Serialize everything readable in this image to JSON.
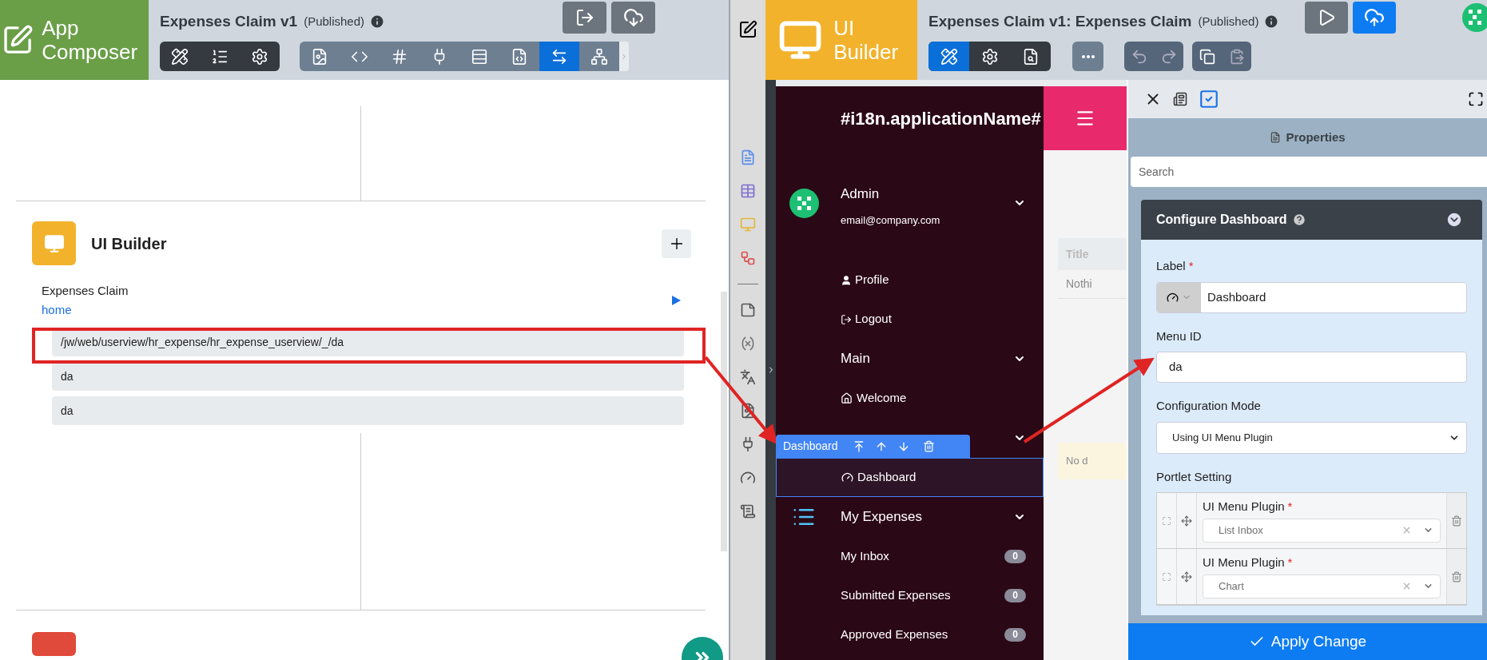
{
  "app_composer": {
    "brand": "App Composer",
    "title": "Expenses Claim v1",
    "status": "(Published)",
    "toolbar_left": [
      {
        "selected": false
      },
      {
        "selected": false
      },
      {
        "selected": false
      }
    ],
    "toolbar_right": [
      {
        "selected": false
      },
      {
        "selected": false
      },
      {
        "selected": false
      },
      {
        "selected": false
      },
      {
        "selected": false
      },
      {
        "selected": false
      },
      {
        "selected": true
      },
      {
        "selected": false
      }
    ],
    "section": {
      "title": "UI Builder",
      "item": {
        "name": "Expenses Claim",
        "link": "home"
      },
      "rows": [
        {
          "text": "/jw/web/userview/hr_expense/hr_expense_userview/_/da"
        },
        {
          "text": "da"
        },
        {
          "text": "da"
        }
      ]
    }
  },
  "ui_builder": {
    "brand": "UI Builder",
    "title": "Expenses Claim v1: Expenses Claim",
    "status": "(Published)",
    "toolbar": [
      {
        "selected": true
      },
      {
        "selected": false
      },
      {
        "selected": false
      }
    ]
  },
  "userview": {
    "app_name": "#i18n.applicationName#",
    "user": {
      "name": "Admin",
      "email": "email@company.com",
      "expanded": true,
      "links": [
        {
          "label": "Profile"
        },
        {
          "label": "Logout"
        }
      ]
    },
    "categories": [
      {
        "label": "Main",
        "expanded": true,
        "items": [
          {
            "label": "Welcome",
            "selected": false
          }
        ]
      },
      {
        "expanded": true,
        "items": [
          {
            "label": "Dashboard",
            "selected": true
          }
        ]
      },
      {
        "label": "My Expenses",
        "expanded": true,
        "items": [
          {
            "label": "My Inbox",
            "count": "0",
            "selected": false
          },
          {
            "label": "Submitted Expenses",
            "count": "0",
            "selected": false
          },
          {
            "label": "Approved Expenses",
            "count": "0",
            "selected": false
          }
        ]
      }
    ],
    "element_toolbar": {
      "label": "Dashboard"
    }
  },
  "background_page": {
    "column_header": "Title",
    "cell": "Nothi",
    "notice": "No d"
  },
  "properties": {
    "tabs": [
      {
        "selected": false
      },
      {
        "selected": true
      }
    ],
    "header": "Properties",
    "search": {
      "placeholder": "Search"
    },
    "card_title": "Configure Dashboard",
    "expanded": true,
    "fields": [
      {
        "kind": "icon_input",
        "label": "Label",
        "required_mark": "*",
        "value": "Dashboard"
      },
      {
        "kind": "input",
        "label": "Menu ID",
        "value": "da"
      },
      {
        "kind": "select",
        "label": "Configuration Mode",
        "value": "Using UI Menu Plugin"
      }
    ],
    "portlet": {
      "label": "Portlet Setting",
      "rows": [
        {
          "label": "UI Menu Plugin",
          "required_mark": "*",
          "value": "List Inbox"
        },
        {
          "label": "UI Menu Plugin",
          "required_mark": "*",
          "value": "Chart"
        }
      ]
    },
    "apply": "Apply Change"
  }
}
